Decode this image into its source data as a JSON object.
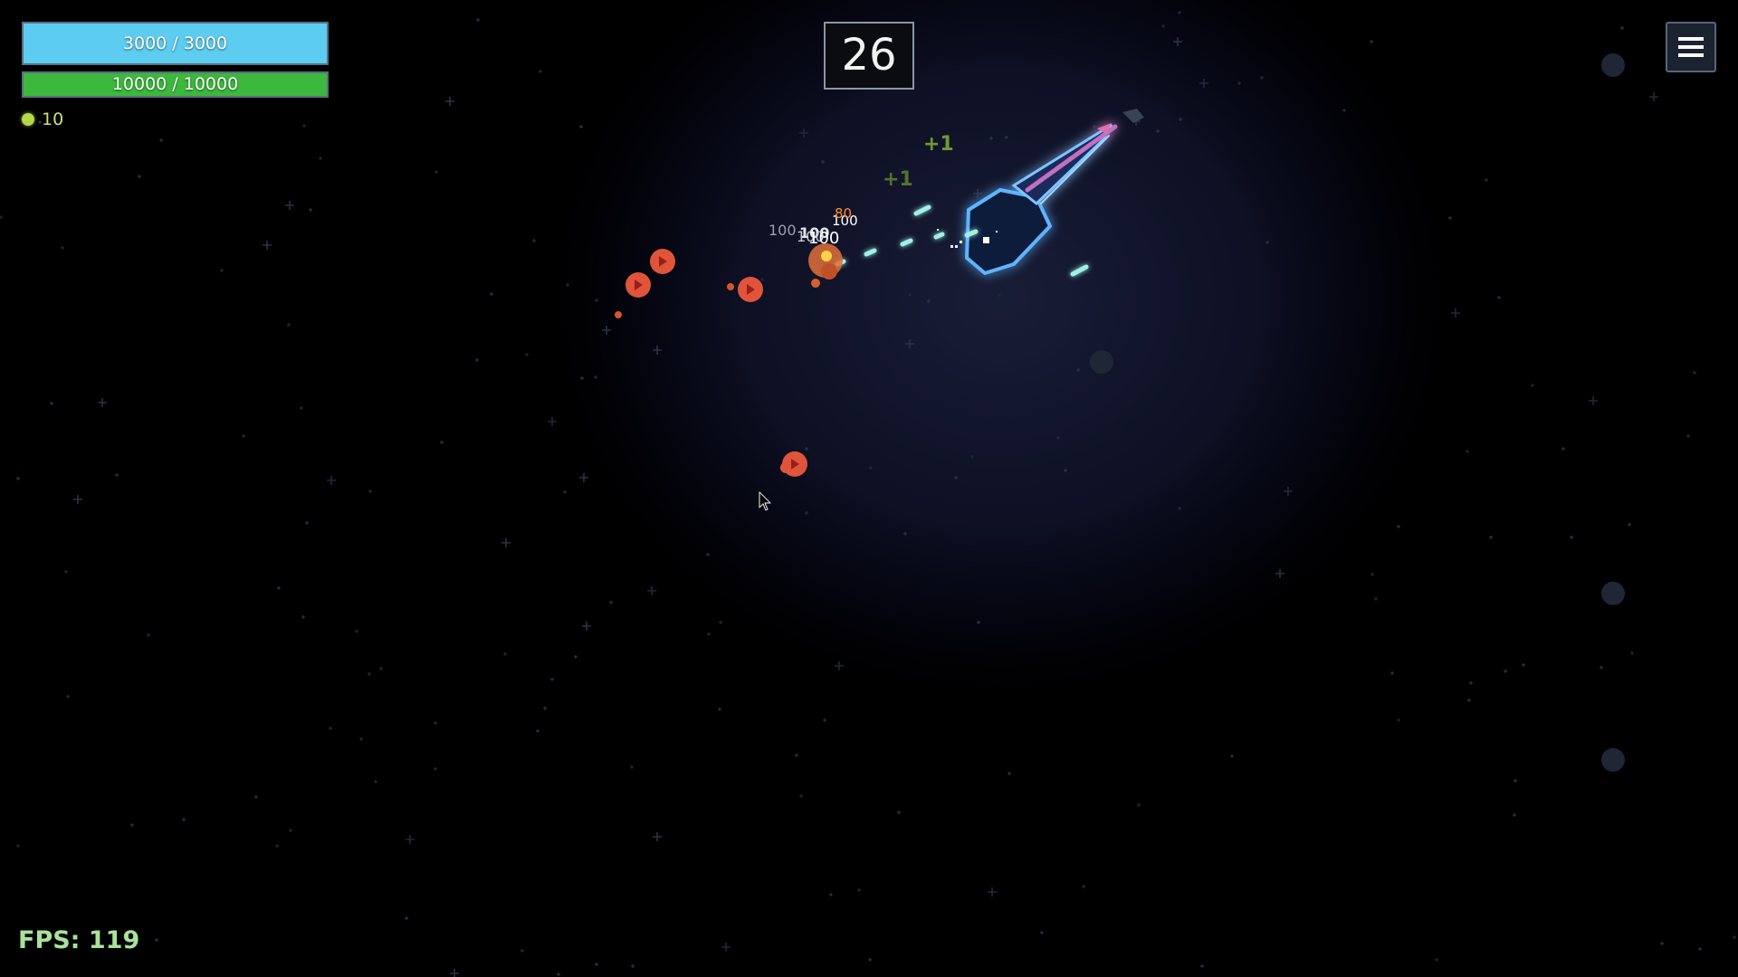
{
  "hud": {
    "shield": {
      "label": "3000 / 3000",
      "fraction": 1.0,
      "color": "#5ccdf0"
    },
    "health": {
      "label": "10000 / 10000",
      "fraction": 1.0,
      "color": "#3cb83c"
    },
    "currency": {
      "icon": "coin-icon",
      "count": "10",
      "color": "#b5d84a"
    }
  },
  "wave": {
    "number": "26"
  },
  "menu": {
    "icon": "hamburger-menu-icon"
  },
  "fps": {
    "label": "FPS: 119"
  },
  "floating_texts": {
    "pickup_1": "+1",
    "pickup_2": "+1",
    "damage_1": "100",
    "damage_2": "100",
    "damage_3": "100",
    "damage_4": "100",
    "damage_5": "100",
    "damage_6": "80"
  },
  "colors": {
    "background": "#000000",
    "nebula": "#1a1f3a",
    "player_glow": "#4aa8ff",
    "player_accent": "#c070c0",
    "laser": "#9ff0e6",
    "enemy": "#e0553a",
    "enemy_core": "#b83024",
    "pickup": "#6f9a2e",
    "damage_text": "#c8cdd6",
    "crit_text": "#ff8a3a"
  }
}
